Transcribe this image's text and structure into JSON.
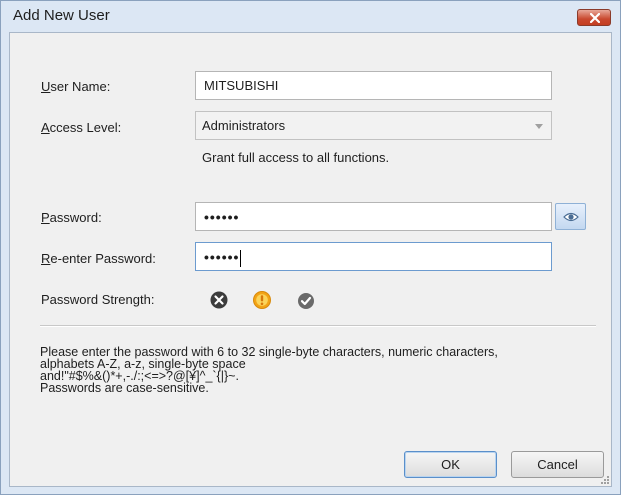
{
  "window": {
    "title": "Add New User"
  },
  "form": {
    "user_name": {
      "label_mnemonic": "U",
      "label_rest": "ser Name:",
      "value": "MITSUBISHI"
    },
    "access_level": {
      "label_mnemonic": "A",
      "label_rest": "ccess Level:",
      "selected": "Administrators",
      "description": "Grant full access to all functions."
    },
    "password": {
      "label_mnemonic": "P",
      "label_rest": "assword:",
      "masked_value": "••••••"
    },
    "reenter_password": {
      "label_mnemonic": "R",
      "label_rest": "e-enter Password:",
      "masked_value": "••••••"
    },
    "strength": {
      "label": "Password Strength:"
    }
  },
  "info": {
    "lines": [
      "Please enter the password with 6 to 32 single-byte characters, numeric characters,",
      "alphabets A-Z, a-z, single-byte space",
      "and!\"#$%&()*+,-./:;<=>?@[¥]^_`{|}~.",
      "Passwords are case-sensitive."
    ]
  },
  "buttons": {
    "ok": "OK",
    "cancel": "Cancel"
  },
  "colors": {
    "titlebar": "#dce7f4",
    "client": "#f0f0f0",
    "close": "#c43e22",
    "strength_weak": "#3c3c3c",
    "strength_warning": "#f2a316",
    "strength_ok": "#6a6a6a"
  },
  "icons": {
    "close": "x-icon",
    "show_password": "eye-icon",
    "strength_weak": "x-circle-icon",
    "strength_warning": "exclamation-circle-icon",
    "strength_ok": "check-circle-icon"
  }
}
